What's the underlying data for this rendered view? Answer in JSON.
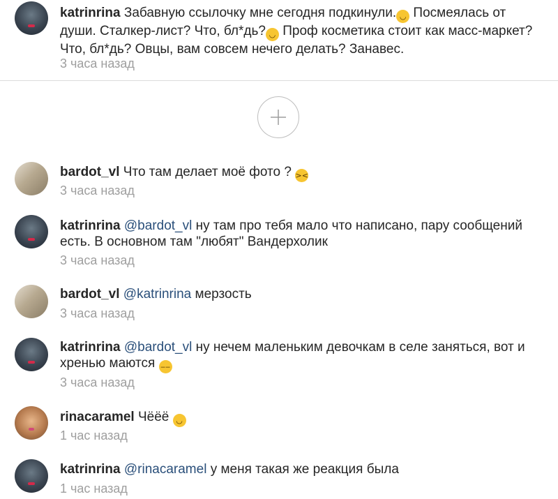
{
  "comments": [
    {
      "avatar": "katrinrina-avatar",
      "username": "katrinrina",
      "parts": [
        {
          "type": "text",
          "value": " Забавную ссылочку мне сегодня подкинули."
        },
        {
          "type": "emoji",
          "name": "grinning-face-emoji",
          "glyph": "😁"
        },
        {
          "type": "text",
          "value": " Посмеялась от души. Сталкер-лист?  Что,  бл*дь?"
        },
        {
          "type": "emoji",
          "name": "grinning-face-emoji",
          "glyph": "😁"
        },
        {
          "type": "text",
          "value": " Проф косметика стоит как масс-маркет?  Что, бл*дь? Овцы, вам совсем нечего делать? Занавес."
        }
      ],
      "time": "3 часа назад"
    },
    {
      "avatar": "bardot-avatar",
      "username": "bardot_vl",
      "parts": [
        {
          "type": "text",
          "value": " Что там делает моё фото ? "
        },
        {
          "type": "emoji",
          "name": "persevering-face-emoji",
          "glyph": "😣"
        }
      ],
      "time": "3 часа назад"
    },
    {
      "avatar": "katrinrina-avatar",
      "username": "katrinrina",
      "parts": [
        {
          "type": "mention",
          "value": " @bardot_vl"
        },
        {
          "type": "text",
          "value": " ну там про тебя мало что написано,  пару сообщений есть.  В основном там \"любят\" Вандерхолик"
        }
      ],
      "time": "3 часа назад"
    },
    {
      "avatar": "bardot-avatar",
      "username": "bardot_vl",
      "parts": [
        {
          "type": "mention",
          "value": " @katrinrina"
        },
        {
          "type": "text",
          "value": " мерзость"
        }
      ],
      "time": "3 часа назад"
    },
    {
      "avatar": "katrinrina-avatar",
      "username": "katrinrina",
      "parts": [
        {
          "type": "mention",
          "value": " @bardot_vl"
        },
        {
          "type": "text",
          "value": " ну нечем маленьким девочкам в селе заняться,  вот и хренью  маются "
        },
        {
          "type": "emoji",
          "name": "unamused-face-emoji",
          "glyph": "😒"
        }
      ],
      "time": "3 часа назад"
    },
    {
      "avatar": "rinacaramel-avatar",
      "username": "rinacaramel",
      "parts": [
        {
          "type": "text",
          "value": " Чёёё "
        },
        {
          "type": "emoji",
          "name": "grinning-face-emoji",
          "glyph": "😁"
        }
      ],
      "time": "1 час назад"
    },
    {
      "avatar": "katrinrina-avatar",
      "username": "katrinrina",
      "parts": [
        {
          "type": "mention",
          "value": " @rinacaramel"
        },
        {
          "type": "text",
          "value": " у меня такая же реакция была"
        }
      ],
      "time": "1 час назад"
    }
  ],
  "load_more": {
    "icon": "plus-icon"
  }
}
